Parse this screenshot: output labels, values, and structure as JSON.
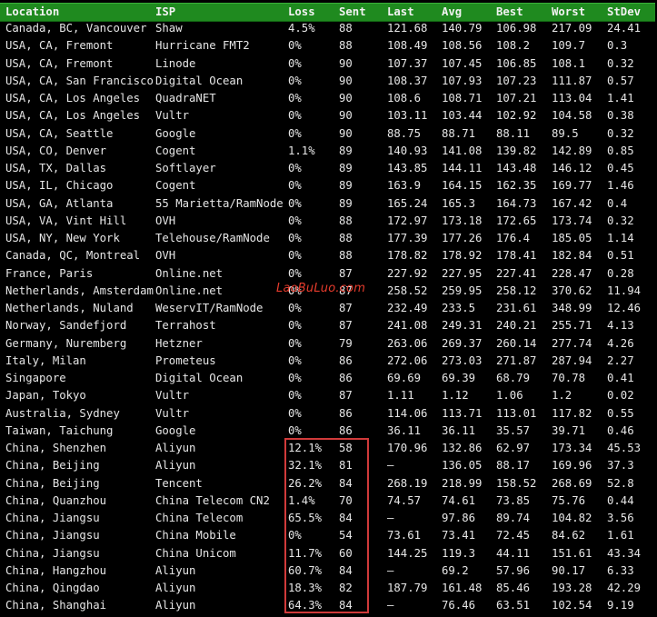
{
  "table": {
    "headers": [
      "Location",
      "ISP",
      "Loss",
      "Sent",
      "Last",
      "Avg",
      "Best",
      "Worst",
      "StDev"
    ],
    "rows": [
      {
        "location": "Canada, BC, Vancouver",
        "isp": "Shaw",
        "loss": "4.5%",
        "sent": "88",
        "last": "121.68",
        "avg": "140.79",
        "best": "106.98",
        "worst": "217.09",
        "stdev": "24.41"
      },
      {
        "location": "USA, CA, Fremont",
        "isp": "Hurricane FMT2",
        "loss": "0%",
        "sent": "88",
        "last": "108.49",
        "avg": "108.56",
        "best": "108.2",
        "worst": "109.7",
        "stdev": "0.3"
      },
      {
        "location": "USA, CA, Fremont",
        "isp": "Linode",
        "loss": "0%",
        "sent": "90",
        "last": "107.37",
        "avg": "107.45",
        "best": "106.85",
        "worst": "108.1",
        "stdev": "0.32"
      },
      {
        "location": "USA, CA, San Francisco",
        "isp": "Digital Ocean",
        "loss": "0%",
        "sent": "90",
        "last": "108.37",
        "avg": "107.93",
        "best": "107.23",
        "worst": "111.87",
        "stdev": "0.57"
      },
      {
        "location": "USA, CA, Los Angeles",
        "isp": "QuadraNET",
        "loss": "0%",
        "sent": "90",
        "last": "108.6",
        "avg": "108.71",
        "best": "107.21",
        "worst": "113.04",
        "stdev": "1.41"
      },
      {
        "location": "USA, CA, Los Angeles",
        "isp": "Vultr",
        "loss": "0%",
        "sent": "90",
        "last": "103.11",
        "avg": "103.44",
        "best": "102.92",
        "worst": "104.58",
        "stdev": "0.38"
      },
      {
        "location": "USA, CA, Seattle",
        "isp": "Google",
        "loss": "0%",
        "sent": "90",
        "last": "88.75",
        "avg": "88.71",
        "best": "88.11",
        "worst": "89.5",
        "stdev": "0.32"
      },
      {
        "location": "USA, CO, Denver",
        "isp": "Cogent",
        "loss": "1.1%",
        "sent": "89",
        "last": "140.93",
        "avg": "141.08",
        "best": "139.82",
        "worst": "142.89",
        "stdev": "0.85"
      },
      {
        "location": "USA, TX, Dallas",
        "isp": "Softlayer",
        "loss": "0%",
        "sent": "89",
        "last": "143.85",
        "avg": "144.11",
        "best": "143.48",
        "worst": "146.12",
        "stdev": "0.45"
      },
      {
        "location": "USA, IL, Chicago",
        "isp": "Cogent",
        "loss": "0%",
        "sent": "89",
        "last": "163.9",
        "avg": "164.15",
        "best": "162.35",
        "worst": "169.77",
        "stdev": "1.46"
      },
      {
        "location": "USA, GA, Atlanta",
        "isp": "55 Marietta/RamNode",
        "loss": "0%",
        "sent": "89",
        "last": "165.24",
        "avg": "165.3",
        "best": "164.73",
        "worst": "167.42",
        "stdev": "0.4"
      },
      {
        "location": "USA, VA, Vint Hill",
        "isp": "OVH",
        "loss": "0%",
        "sent": "88",
        "last": "172.97",
        "avg": "173.18",
        "best": "172.65",
        "worst": "173.74",
        "stdev": "0.32"
      },
      {
        "location": "USA, NY, New York",
        "isp": "Telehouse/RamNode",
        "loss": "0%",
        "sent": "88",
        "last": "177.39",
        "avg": "177.26",
        "best": "176.4",
        "worst": "185.05",
        "stdev": "1.14"
      },
      {
        "location": "Canada, QC, Montreal",
        "isp": "OVH",
        "loss": "0%",
        "sent": "88",
        "last": "178.82",
        "avg": "178.92",
        "best": "178.41",
        "worst": "182.84",
        "stdev": "0.51"
      },
      {
        "location": "France, Paris",
        "isp": "Online.net",
        "loss": "0%",
        "sent": "87",
        "last": "227.92",
        "avg": "227.95",
        "best": "227.41",
        "worst": "228.47",
        "stdev": "0.28"
      },
      {
        "location": "Netherlands, Amsterdam",
        "isp": "Online.net",
        "loss": "0%",
        "sent": "87",
        "last": "258.52",
        "avg": "259.95",
        "best": "258.12",
        "worst": "370.62",
        "stdev": "11.94"
      },
      {
        "location": "Netherlands, Nuland",
        "isp": "WeservIT/RamNode",
        "loss": "0%",
        "sent": "87",
        "last": "232.49",
        "avg": "233.5",
        "best": "231.61",
        "worst": "348.99",
        "stdev": "12.46"
      },
      {
        "location": "Norway, Sandefjord",
        "isp": "Terrahost",
        "loss": "0%",
        "sent": "87",
        "last": "241.08",
        "avg": "249.31",
        "best": "240.21",
        "worst": "255.71",
        "stdev": "4.13"
      },
      {
        "location": "Germany, Nuremberg",
        "isp": "Hetzner",
        "loss": "0%",
        "sent": "79",
        "last": "263.06",
        "avg": "269.37",
        "best": "260.14",
        "worst": "277.74",
        "stdev": "4.26"
      },
      {
        "location": "Italy, Milan",
        "isp": "Prometeus",
        "loss": "0%",
        "sent": "86",
        "last": "272.06",
        "avg": "273.03",
        "best": "271.87",
        "worst": "287.94",
        "stdev": "2.27"
      },
      {
        "location": "Singapore",
        "isp": "Digital Ocean",
        "loss": "0%",
        "sent": "86",
        "last": "69.69",
        "avg": "69.39",
        "best": "68.79",
        "worst": "70.78",
        "stdev": "0.41"
      },
      {
        "location": "Japan, Tokyo",
        "isp": "Vultr",
        "loss": "0%",
        "sent": "87",
        "last": "1.11",
        "avg": "1.12",
        "best": "1.06",
        "worst": "1.2",
        "stdev": "0.02"
      },
      {
        "location": "Australia, Sydney",
        "isp": "Vultr",
        "loss": "0%",
        "sent": "86",
        "last": "114.06",
        "avg": "113.71",
        "best": "113.01",
        "worst": "117.82",
        "stdev": "0.55"
      },
      {
        "location": "Taiwan, Taichung",
        "isp": "Google",
        "loss": "0%",
        "sent": "86",
        "last": "36.11",
        "avg": "36.11",
        "best": "35.57",
        "worst": "39.71",
        "stdev": "0.46"
      },
      {
        "location": "China, Shenzhen",
        "isp": "Aliyun",
        "loss": "12.1%",
        "sent": "58",
        "last": "170.96",
        "avg": "132.86",
        "best": "62.97",
        "worst": "173.34",
        "stdev": "45.53"
      },
      {
        "location": "China, Beijing",
        "isp": "Aliyun",
        "loss": "32.1%",
        "sent": "81",
        "last": "–",
        "avg": "136.05",
        "best": "88.17",
        "worst": "169.96",
        "stdev": "37.3"
      },
      {
        "location": "China, Beijing",
        "isp": "Tencent",
        "loss": "26.2%",
        "sent": "84",
        "last": "268.19",
        "avg": "218.99",
        "best": "158.52",
        "worst": "268.69",
        "stdev": "52.8"
      },
      {
        "location": "China, Quanzhou",
        "isp": "China Telecom CN2",
        "loss": "1.4%",
        "sent": "70",
        "last": "74.57",
        "avg": "74.61",
        "best": "73.85",
        "worst": "75.76",
        "stdev": "0.44"
      },
      {
        "location": "China, Jiangsu",
        "isp": "China Telecom",
        "loss": "65.5%",
        "sent": "84",
        "last": "–",
        "avg": "97.86",
        "best": "89.74",
        "worst": "104.82",
        "stdev": "3.56"
      },
      {
        "location": "China, Jiangsu",
        "isp": "China Mobile",
        "loss": "0%",
        "sent": "54",
        "last": "73.61",
        "avg": "73.41",
        "best": "72.45",
        "worst": "84.62",
        "stdev": "1.61"
      },
      {
        "location": "China, Jiangsu",
        "isp": "China Unicom",
        "loss": "11.7%",
        "sent": "60",
        "last": "144.25",
        "avg": "119.3",
        "best": "44.11",
        "worst": "151.61",
        "stdev": "43.34"
      },
      {
        "location": "China, Hangzhou",
        "isp": "Aliyun",
        "loss": "60.7%",
        "sent": "84",
        "last": "–",
        "avg": "69.2",
        "best": "57.96",
        "worst": "90.17",
        "stdev": "6.33"
      },
      {
        "location": "China, Qingdao",
        "isp": "Aliyun",
        "loss": "18.3%",
        "sent": "82",
        "last": "187.79",
        "avg": "161.48",
        "best": "85.46",
        "worst": "193.28",
        "stdev": "42.29"
      },
      {
        "location": "China, Shanghai",
        "isp": "Aliyun",
        "loss": "64.3%",
        "sent": "84",
        "last": "–",
        "avg": "76.46",
        "best": "63.51",
        "worst": "102.54",
        "stdev": "9.19"
      }
    ]
  },
  "watermark": "LaoBuLuo.com",
  "colors": {
    "background": "#000000",
    "header": "#1f8a1f",
    "text": "#e6e6e6",
    "highlight": "#d03a3a",
    "watermark": "#e53b2c"
  }
}
